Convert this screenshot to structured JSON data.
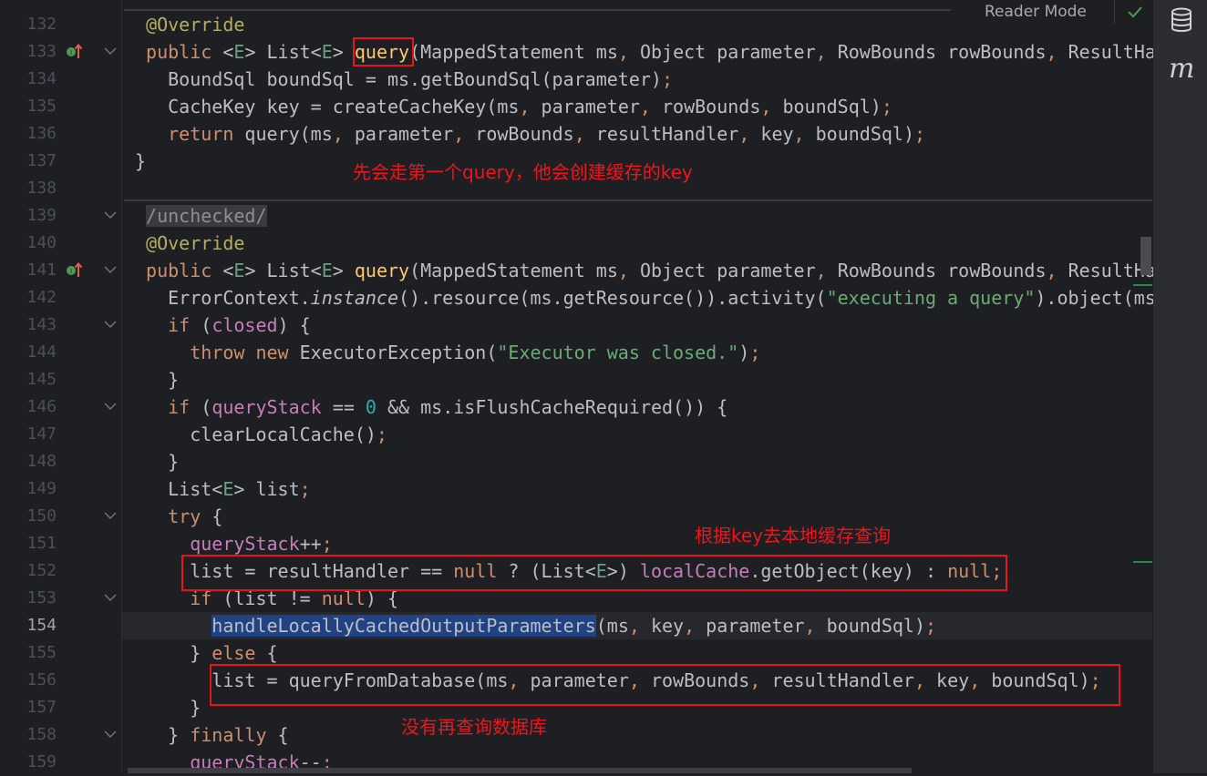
{
  "toolbar": {
    "reader_mode_label": "Reader Mode",
    "status_icon": "check-icon"
  },
  "sidebar": {
    "database_icon": "database-icon",
    "maven_label": "m"
  },
  "editor": {
    "current_line": 154,
    "lines": [
      {
        "n": 132,
        "fold": false,
        "marker": false,
        "tokens": [
          [
            " @Override",
            "ann"
          ]
        ]
      },
      {
        "n": 133,
        "fold": true,
        "marker": true,
        "tokens": [
          [
            " public",
            "kw"
          ],
          [
            " <",
            ""
          ],
          [
            "E",
            "tp"
          ],
          [
            "> List<",
            ""
          ],
          [
            "E",
            "tp"
          ],
          [
            "> ",
            ""
          ],
          [
            "query",
            "decl"
          ],
          [
            "(MappedStatement ms",
            ""
          ],
          [
            ",",
            "pun"
          ],
          [
            " Object parameter",
            ""
          ],
          [
            ",",
            "pun"
          ],
          [
            " RowBounds rowBounds",
            ""
          ],
          [
            ",",
            "pun"
          ],
          [
            " ResultHa",
            ""
          ]
        ]
      },
      {
        "n": 134,
        "fold": false,
        "marker": false,
        "tokens": [
          [
            "   BoundSql boundSql = ms.getBoundSql(parameter)",
            ""
          ],
          [
            ";",
            "pun"
          ]
        ]
      },
      {
        "n": 135,
        "fold": false,
        "marker": false,
        "tokens": [
          [
            "   CacheKey key = createCacheKey(ms",
            ""
          ],
          [
            ",",
            "pun"
          ],
          [
            " parameter",
            ""
          ],
          [
            ",",
            "pun"
          ],
          [
            " rowBounds",
            ""
          ],
          [
            ",",
            "pun"
          ],
          [
            " boundSql)",
            ""
          ],
          [
            ";",
            "pun"
          ]
        ]
      },
      {
        "n": 136,
        "fold": false,
        "marker": false,
        "tokens": [
          [
            "   return",
            "kw"
          ],
          [
            " query(ms",
            ""
          ],
          [
            ",",
            "pun"
          ],
          [
            " parameter",
            ""
          ],
          [
            ",",
            "pun"
          ],
          [
            " rowBounds",
            ""
          ],
          [
            ",",
            "pun"
          ],
          [
            " resultHandler",
            ""
          ],
          [
            ",",
            "pun"
          ],
          [
            " key",
            ""
          ],
          [
            ",",
            "pun"
          ],
          [
            " boundSql)",
            ""
          ],
          [
            ";",
            "pun"
          ]
        ]
      },
      {
        "n": 137,
        "fold": false,
        "marker": false,
        "tokens": [
          [
            "}",
            ""
          ]
        ]
      },
      {
        "n": 138,
        "fold": false,
        "marker": false,
        "tokens": []
      },
      {
        "n": 139,
        "fold": true,
        "marker": false,
        "tokens": [
          [
            " ",
            ""
          ],
          [
            "/unchecked/",
            "cmt"
          ]
        ]
      },
      {
        "n": 140,
        "fold": false,
        "marker": false,
        "tokens": [
          [
            " @Override",
            "ann"
          ]
        ]
      },
      {
        "n": 141,
        "fold": true,
        "marker": true,
        "tokens": [
          [
            " public",
            "kw"
          ],
          [
            " <",
            ""
          ],
          [
            "E",
            "tp"
          ],
          [
            "> List<",
            ""
          ],
          [
            "E",
            "tp"
          ],
          [
            "> ",
            ""
          ],
          [
            "query",
            "decl"
          ],
          [
            "(MappedStatement ms",
            ""
          ],
          [
            ",",
            "pun"
          ],
          [
            " Object parameter",
            ""
          ],
          [
            ",",
            "pun"
          ],
          [
            " RowBounds rowBounds",
            ""
          ],
          [
            ",",
            "pun"
          ],
          [
            " ResultHa",
            ""
          ]
        ]
      },
      {
        "n": 142,
        "fold": false,
        "marker": false,
        "tokens": [
          [
            "   ErrorContext.",
            ""
          ],
          [
            "instance",
            "ital"
          ],
          [
            "().resource(ms.getResource()).activity(",
            ""
          ],
          [
            "\"executing a query\"",
            "str"
          ],
          [
            ").object(ms",
            ""
          ]
        ]
      },
      {
        "n": 143,
        "fold": true,
        "marker": false,
        "tokens": [
          [
            "   if",
            "kw"
          ],
          [
            " (",
            ""
          ],
          [
            "closed",
            "fld"
          ],
          [
            ") {",
            ""
          ]
        ]
      },
      {
        "n": 144,
        "fold": false,
        "marker": false,
        "tokens": [
          [
            "     throw new",
            "kw"
          ],
          [
            " ExecutorException(",
            ""
          ],
          [
            "\"Executor was closed.\"",
            "str"
          ],
          [
            ")",
            ""
          ],
          [
            ";",
            "pun"
          ]
        ]
      },
      {
        "n": 145,
        "fold": false,
        "marker": false,
        "tokens": [
          [
            "   }",
            ""
          ]
        ]
      },
      {
        "n": 146,
        "fold": true,
        "marker": false,
        "tokens": [
          [
            "   if",
            "kw"
          ],
          [
            " (",
            ""
          ],
          [
            "queryStack",
            "fld"
          ],
          [
            " == ",
            ""
          ],
          [
            "0",
            "num"
          ],
          [
            " && ms.isFlushCacheRequired()) {",
            ""
          ]
        ]
      },
      {
        "n": 147,
        "fold": false,
        "marker": false,
        "tokens": [
          [
            "     clearLocalCache()",
            ""
          ],
          [
            ";",
            "pun"
          ]
        ]
      },
      {
        "n": 148,
        "fold": false,
        "marker": false,
        "tokens": [
          [
            "   }",
            ""
          ]
        ]
      },
      {
        "n": 149,
        "fold": false,
        "marker": false,
        "tokens": [
          [
            "   List<",
            ""
          ],
          [
            "E",
            "tp"
          ],
          [
            "> list",
            ""
          ],
          [
            ";",
            "pun"
          ]
        ]
      },
      {
        "n": 150,
        "fold": true,
        "marker": false,
        "tokens": [
          [
            "   try",
            "kw"
          ],
          [
            " {",
            ""
          ]
        ]
      },
      {
        "n": 151,
        "fold": false,
        "marker": false,
        "tokens": [
          [
            "     ",
            ""
          ],
          [
            "queryStack",
            "fld"
          ],
          [
            "++",
            ""
          ],
          [
            ";",
            "pun"
          ]
        ]
      },
      {
        "n": 152,
        "fold": false,
        "marker": false,
        "tokens": [
          [
            "     list = resultHandler == ",
            ""
          ],
          [
            "null",
            "kw"
          ],
          [
            " ? (List<",
            ""
          ],
          [
            "E",
            "tp"
          ],
          [
            ">) ",
            ""
          ],
          [
            "localCache",
            "fld"
          ],
          [
            ".getObject(key) : ",
            ""
          ],
          [
            "null",
            "kw"
          ],
          [
            ";",
            "pun"
          ]
        ]
      },
      {
        "n": 153,
        "fold": true,
        "marker": false,
        "tokens": [
          [
            "     if",
            "kw"
          ],
          [
            " (list != ",
            ""
          ],
          [
            "null",
            "kw"
          ],
          [
            ") {",
            ""
          ]
        ]
      },
      {
        "n": 154,
        "fold": false,
        "marker": false,
        "tokens": [
          [
            "       ",
            ""
          ],
          [
            "handleLocallyCachedOutputParameters",
            "sel"
          ],
          [
            "(ms",
            ""
          ],
          [
            ",",
            "pun"
          ],
          [
            " key",
            ""
          ],
          [
            ",",
            "pun"
          ],
          [
            " parameter",
            ""
          ],
          [
            ",",
            "pun"
          ],
          [
            " boundSql)",
            ""
          ],
          [
            ";",
            "pun"
          ]
        ]
      },
      {
        "n": 155,
        "fold": false,
        "marker": false,
        "tokens": [
          [
            "     } ",
            ""
          ],
          [
            "else",
            "kw"
          ],
          [
            " {",
            ""
          ]
        ]
      },
      {
        "n": 156,
        "fold": false,
        "marker": false,
        "tokens": [
          [
            "       list = queryFromDatabase(ms",
            ""
          ],
          [
            ",",
            "pun"
          ],
          [
            " parameter",
            ""
          ],
          [
            ",",
            "pun"
          ],
          [
            " rowBounds",
            ""
          ],
          [
            ",",
            "pun"
          ],
          [
            " resultHandler",
            ""
          ],
          [
            ",",
            "pun"
          ],
          [
            " key",
            ""
          ],
          [
            ",",
            "pun"
          ],
          [
            " boundSql)",
            ""
          ],
          [
            ";",
            "pun"
          ]
        ]
      },
      {
        "n": 157,
        "fold": false,
        "marker": false,
        "tokens": [
          [
            "     }",
            ""
          ]
        ]
      },
      {
        "n": 158,
        "fold": true,
        "marker": false,
        "tokens": [
          [
            "   } ",
            ""
          ],
          [
            "finally",
            "kw"
          ],
          [
            " {",
            ""
          ]
        ]
      },
      {
        "n": 159,
        "fold": false,
        "marker": false,
        "tokens": [
          [
            "     ",
            ""
          ],
          [
            "queryStack",
            "fld"
          ],
          [
            "--",
            ""
          ],
          [
            ";",
            "pun"
          ]
        ]
      }
    ]
  },
  "annotations": {
    "note1": "先会走第一个query，他会创建缓存的key",
    "note2": "根据key去本地缓存查询",
    "note3": "没有再查询数据库",
    "color": "#e8141b"
  }
}
